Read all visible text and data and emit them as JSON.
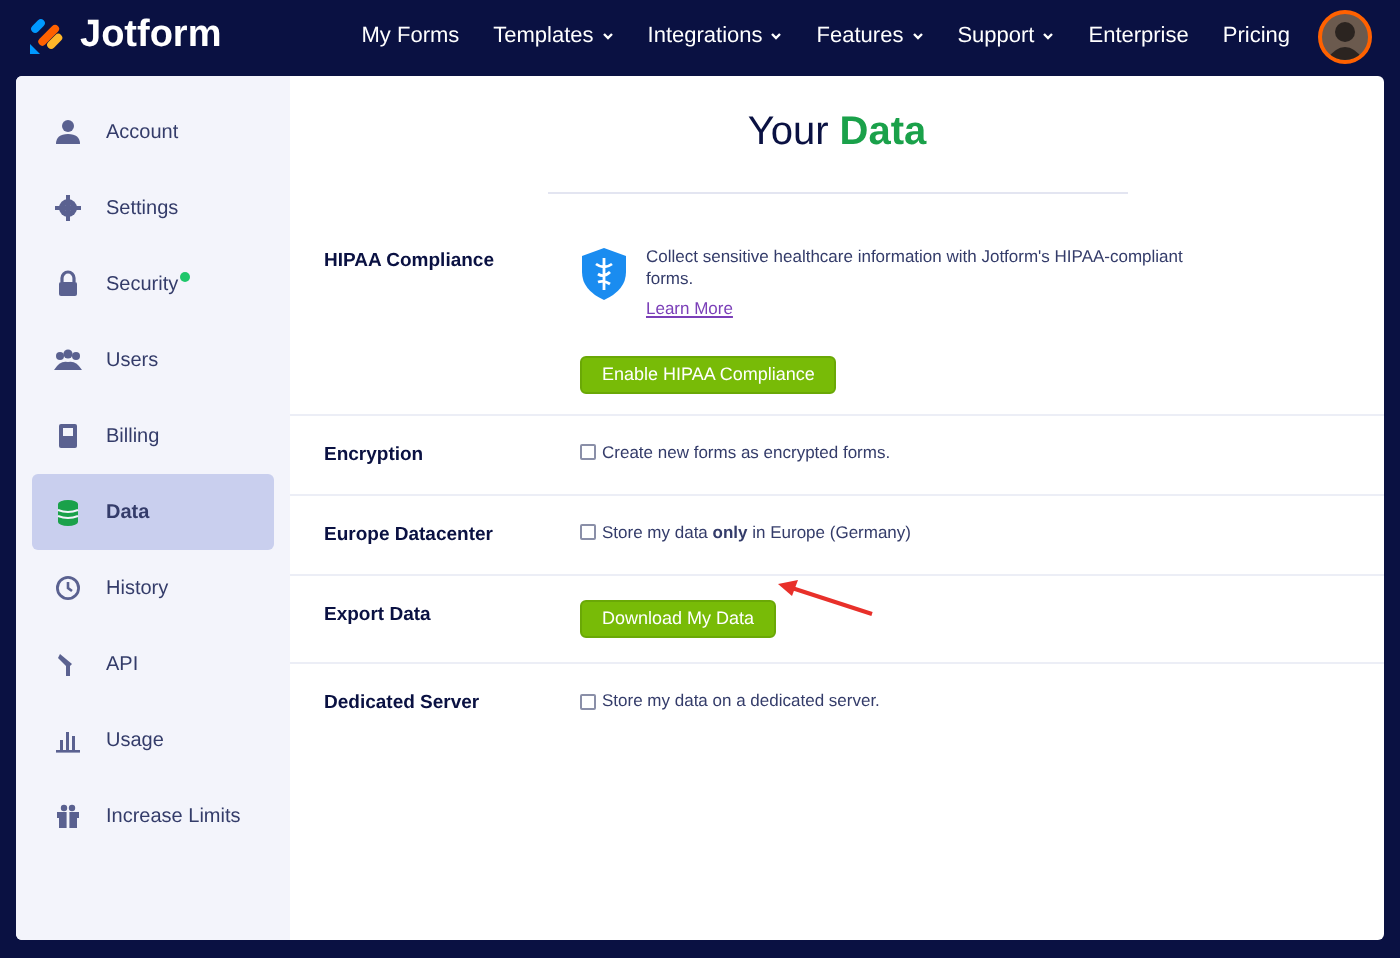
{
  "navbar": {
    "logo": "Jotform",
    "links": [
      {
        "label": "My Forms",
        "has_menu": false
      },
      {
        "label": "Templates",
        "has_menu": true
      },
      {
        "label": "Integrations",
        "has_menu": true
      },
      {
        "label": "Features",
        "has_menu": true
      },
      {
        "label": "Support",
        "has_menu": true
      },
      {
        "label": "Enterprise",
        "has_menu": false
      },
      {
        "label": "Pricing",
        "has_menu": false
      }
    ]
  },
  "sidebar": {
    "items": [
      {
        "label": "Account",
        "selected": false,
        "badge": false
      },
      {
        "label": "Settings",
        "selected": false,
        "badge": false
      },
      {
        "label": "Security",
        "selected": false,
        "badge": true
      },
      {
        "label": "Users",
        "selected": false,
        "badge": false
      },
      {
        "label": "Billing",
        "selected": false,
        "badge": false
      },
      {
        "label": "Data",
        "selected": true,
        "badge": false
      },
      {
        "label": "History",
        "selected": false,
        "badge": false
      },
      {
        "label": "API",
        "selected": false,
        "badge": false
      },
      {
        "label": "Usage",
        "selected": false,
        "badge": false
      },
      {
        "label": "Increase Limits",
        "selected": false,
        "badge": false
      }
    ]
  },
  "page": {
    "title": "Your",
    "title_highlight": "Data"
  },
  "rows": [
    {
      "kind": "info",
      "label": "HIPAA Compliance",
      "text": "Collect sensitive healthcare information with Jotform's HIPAA-compliant forms.",
      "link": "Learn More",
      "button": "Enable HIPAA Compliance"
    },
    {
      "kind": "checkbox",
      "label": "Encryption",
      "text": "Create new forms as encrypted forms.",
      "checked": false
    },
    {
      "kind": "checkbox",
      "label": "Europe Datacenter",
      "text": "Store my data **only** in Europe (Germany)",
      "checked": false
    },
    {
      "kind": "button",
      "label": "Export Data",
      "button": "Download My Data"
    },
    {
      "kind": "checkbox",
      "label": "Dedicated Server",
      "text": "Store my data on a dedicated server.",
      "checked": false
    }
  ]
}
